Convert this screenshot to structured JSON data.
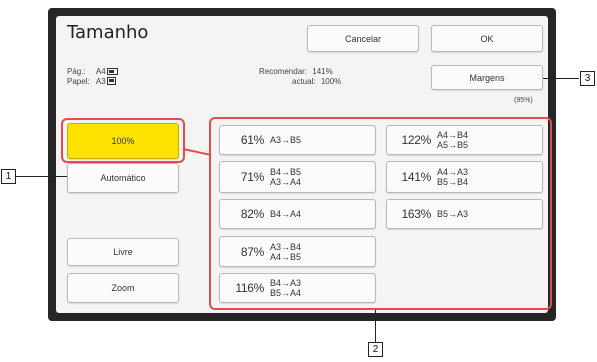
{
  "header": {
    "title": "Tamanho",
    "cancel_label": "Cancelar",
    "ok_label": "OK"
  },
  "info": {
    "page_label": "Pág.:",
    "page_size": "A4",
    "paper_label": "Papel:",
    "paper_size": "A3",
    "recommended_label": "Recomendar:",
    "recommended_value": "141%",
    "current_label": "actual:",
    "current_value": "100%"
  },
  "margins": {
    "button_label": "Margens",
    "value": "(95%)"
  },
  "left_buttons": {
    "selected_label": "100%",
    "auto_label": "Automático",
    "free_label": "Livre",
    "zoom_label": "Zoom"
  },
  "zoom_presets": [
    {
      "pct": "61%",
      "line1": "A3→B5",
      "line2": ""
    },
    {
      "pct": "71%",
      "line1": "B4→B5",
      "line2": "A3→A4"
    },
    {
      "pct": "82%",
      "line1": "B4→A4",
      "line2": ""
    },
    {
      "pct": "87%",
      "line1": "A3→B4",
      "line2": "A4→B5"
    },
    {
      "pct": "116%",
      "line1": "B4→A3",
      "line2": "B5→A4"
    },
    {
      "pct": "122%",
      "line1": "A4→B4",
      "line2": "A5→B5"
    },
    {
      "pct": "141%",
      "line1": "A4→A3",
      "line2": "B5→B4"
    },
    {
      "pct": "163%",
      "line1": "B5→A3",
      "line2": ""
    }
  ],
  "callouts": {
    "c1": "1",
    "c2": "2",
    "c3": "3"
  },
  "colors": {
    "selected": "#ffe300",
    "highlight": "#e84b4b",
    "bezel": "#262626"
  }
}
